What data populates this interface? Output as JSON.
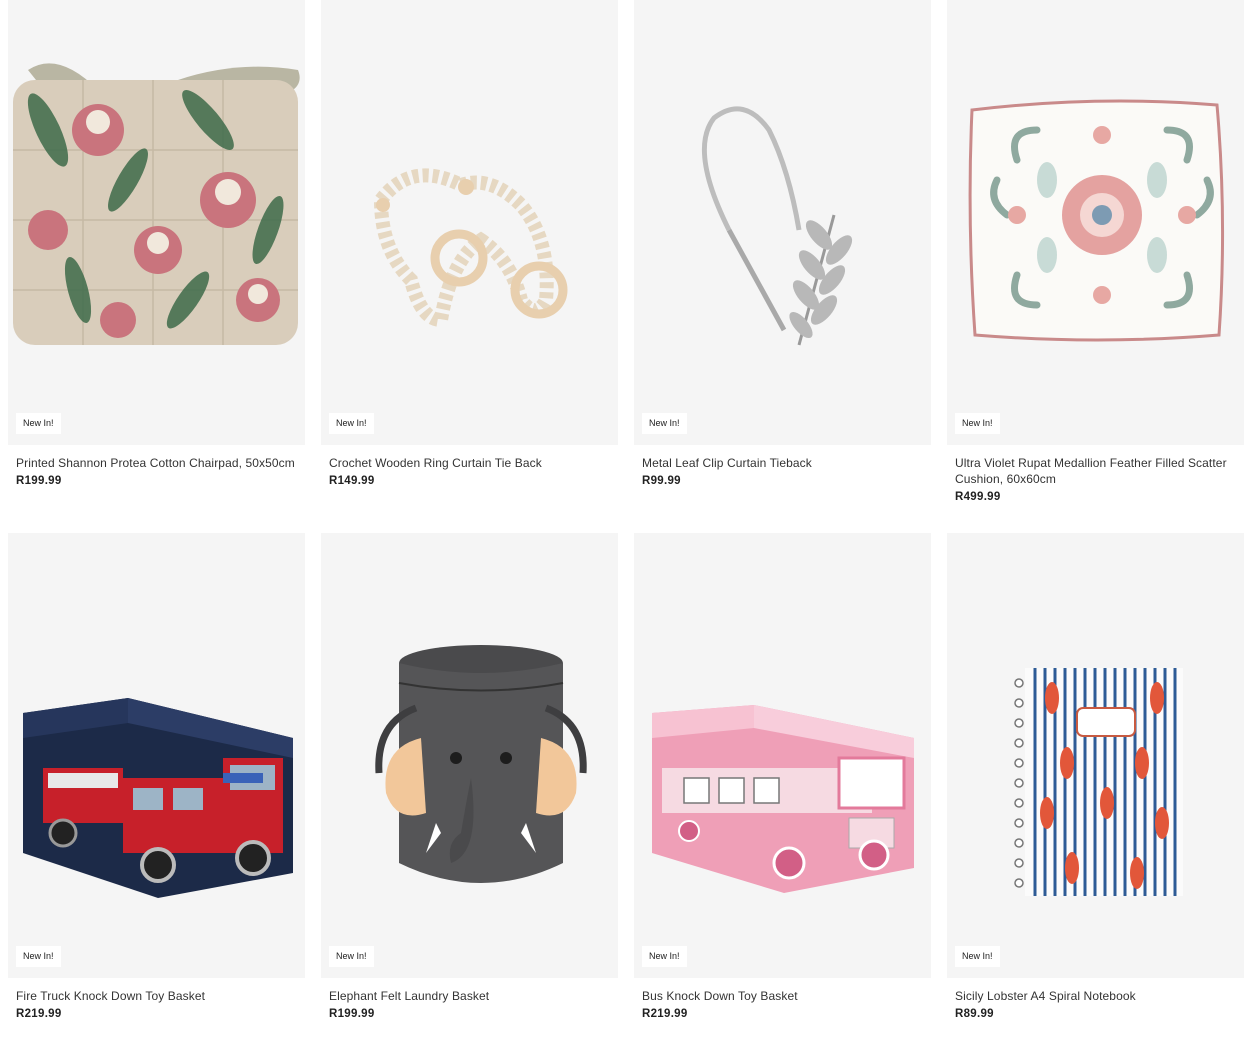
{
  "products": [
    {
      "name": "Printed Shannon Protea Cotton Chairpad, 50x50cm",
      "price": "R199.99",
      "badge": "New In!",
      "image": "protea-chairpad-image"
    },
    {
      "name": "Crochet Wooden Ring Curtain Tie Back",
      "price": "R149.99",
      "badge": "New In!",
      "image": "crochet-tieback-image"
    },
    {
      "name": "Metal Leaf Clip Curtain Tieback",
      "price": "R99.99",
      "badge": "New In!",
      "image": "leaf-tieback-image"
    },
    {
      "name": "Ultra Violet Rupat Medallion Feather Filled Scatter Cushion, 60x60cm",
      "price": "R499.99",
      "badge": "New In!",
      "image": "medallion-cushion-image"
    },
    {
      "name": "Fire Truck Knock Down Toy Basket",
      "price": "R219.99",
      "badge": "New In!",
      "image": "fire-truck-basket-image"
    },
    {
      "name": "Elephant Felt Laundry Basket",
      "price": "R199.99",
      "badge": "New In!",
      "image": "elephant-basket-image"
    },
    {
      "name": "Bus Knock Down Toy Basket",
      "price": "R219.99",
      "badge": "New In!",
      "image": "bus-basket-image"
    },
    {
      "name": "Sicily Lobster A4 Spiral Notebook",
      "price": "R89.99",
      "badge": "New In!",
      "image": "lobster-notebook-image"
    }
  ],
  "colors": {
    "image_bg": "#f5f5f5",
    "text": "#333333",
    "price": "#222222"
  }
}
